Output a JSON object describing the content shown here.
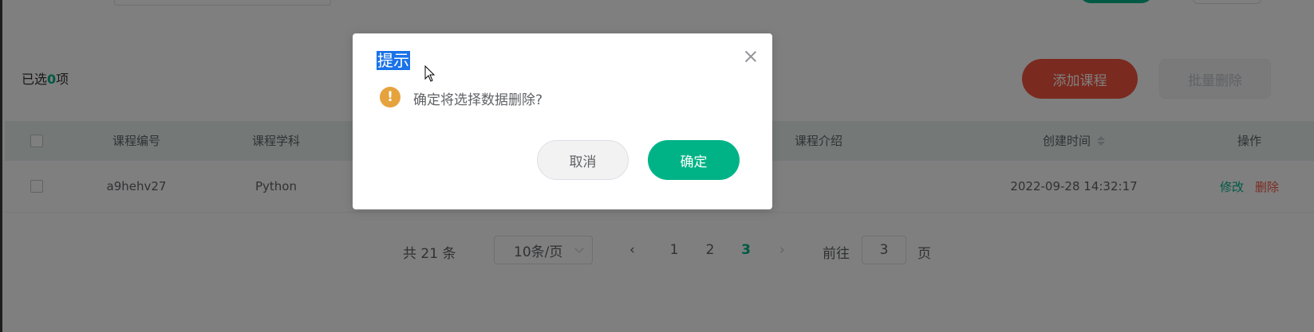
{
  "toolbar": {
    "selected_prefix": "已选",
    "selected_count": "0",
    "selected_suffix": "项",
    "add_course_label": "添加课程",
    "batch_delete_label": "批量删除"
  },
  "table": {
    "headers": {
      "course_no": "课程编号",
      "course_subject": "课程学科",
      "course_intro": "课程介绍",
      "created_time": "创建时间",
      "actions": "操作"
    },
    "rows": [
      {
        "course_no": "a9hehv27",
        "course_subject": "Python",
        "created_time": "2022-09-28 14:32:17",
        "edit_label": "修改",
        "delete_label": "删除"
      }
    ]
  },
  "pagination": {
    "total_text": "共 21 条",
    "page_size": "10条/页",
    "pages": [
      "1",
      "2",
      "3"
    ],
    "current_page": "3",
    "goto_label": "前往",
    "goto_value": "3",
    "goto_unit": "页"
  },
  "dialog": {
    "title": "提示",
    "message": "确定将选择数据删除?",
    "cancel_label": "取消",
    "confirm_label": "确定"
  },
  "colors": {
    "accent": "#00b386",
    "danger": "#f5553f",
    "warning": "#e6a23c"
  },
  "icons": [
    "close-icon",
    "warning-icon",
    "sort-icon",
    "chevron-down-icon",
    "chevron-left-icon",
    "chevron-right-icon",
    "mouse-cursor-icon"
  ]
}
